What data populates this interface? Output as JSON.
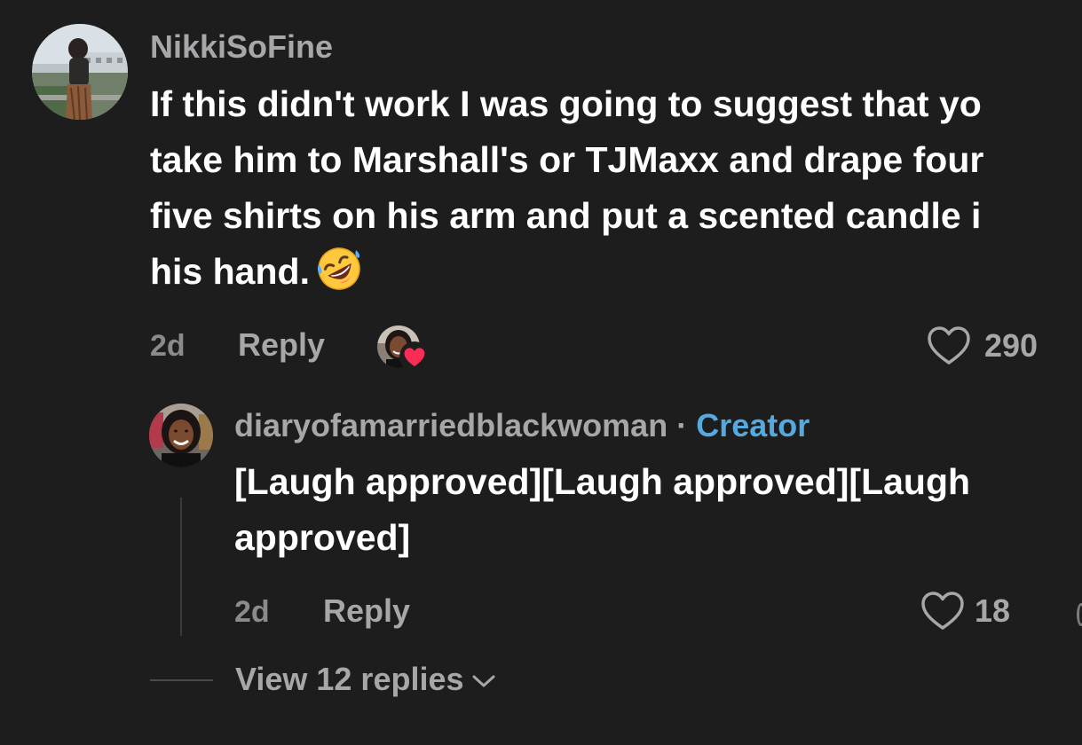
{
  "comment": {
    "username": "NikkiSoFine",
    "lines": [
      "If this didn't work I was going to suggest that yo",
      "take him to Marshall's or TJMaxx and drape four",
      "five shirts on his arm and put a scented candle i",
      "his hand."
    ],
    "emoji": "rolling-on-floor-laughing-emoji",
    "time": "2d",
    "reply_label": "Reply",
    "like_count": "290",
    "liked_by_creator": true
  },
  "reply": {
    "username": "diaryofamarriedblackwoman",
    "separator": "·",
    "badge": "Creator",
    "lines": [
      "[Laugh approved][Laugh approved][Laugh",
      "approved]"
    ],
    "time": "2d",
    "reply_label": "Reply",
    "like_count": "18"
  },
  "view_replies_label": "View 12 replies",
  "colors": {
    "background": "#1d1d1e",
    "text": "#ffffff",
    "muted": "#a7a7a9",
    "creator_badge": "#56a9dc",
    "heart_red": "#fe2c55"
  }
}
